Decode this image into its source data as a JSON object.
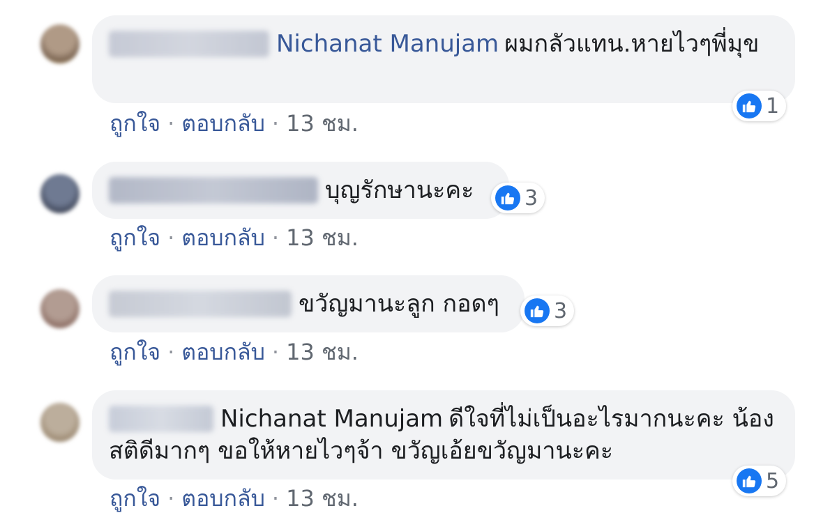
{
  "colors": {
    "like_blue": "#1877f2",
    "link": "#385898",
    "meta": "#606770",
    "bubble": "#f2f3f5"
  },
  "comments": [
    {
      "mention": "Nichanat Manujam",
      "text": "ผมกลัวแทน.หายไวๆพี่มุข",
      "like_label": "ถูกใจ",
      "reply_label": "ตอบกลับ",
      "time": "13 ชม.",
      "reaction_icon": "like-icon",
      "reaction_count": "1",
      "avatar_color": "#a58a6c"
    },
    {
      "mention": "",
      "text": "บุญรักษานะคะ",
      "like_label": "ถูกใจ",
      "reply_label": "ตอบกลับ",
      "time": "13 ชม.",
      "reaction_icon": "like-icon",
      "reaction_count": "3",
      "avatar_color": "#5a6378"
    },
    {
      "mention": "",
      "text": "ขวัญมานะลูก กอดๆ",
      "like_label": "ถูกใจ",
      "reply_label": "ตอบกลับ",
      "time": "13 ชม.",
      "reaction_icon": "like-icon",
      "reaction_count": "3",
      "avatar_color": "#9a7f75"
    },
    {
      "mention": "Nichanat Manujam",
      "text": "ดีใจที่ไม่เป็นอะไรมากนะคะ น้องสติดีมากๆ ขอให้หายไวๆจ้า ขวัญเอ้ยขวัญมานะคะ",
      "like_label": "ถูกใจ",
      "reply_label": "ตอบกลับ",
      "time": "13 ชม.",
      "reaction_icon": "like-icon",
      "reaction_count": "5",
      "avatar_color": "#a89884"
    }
  ]
}
